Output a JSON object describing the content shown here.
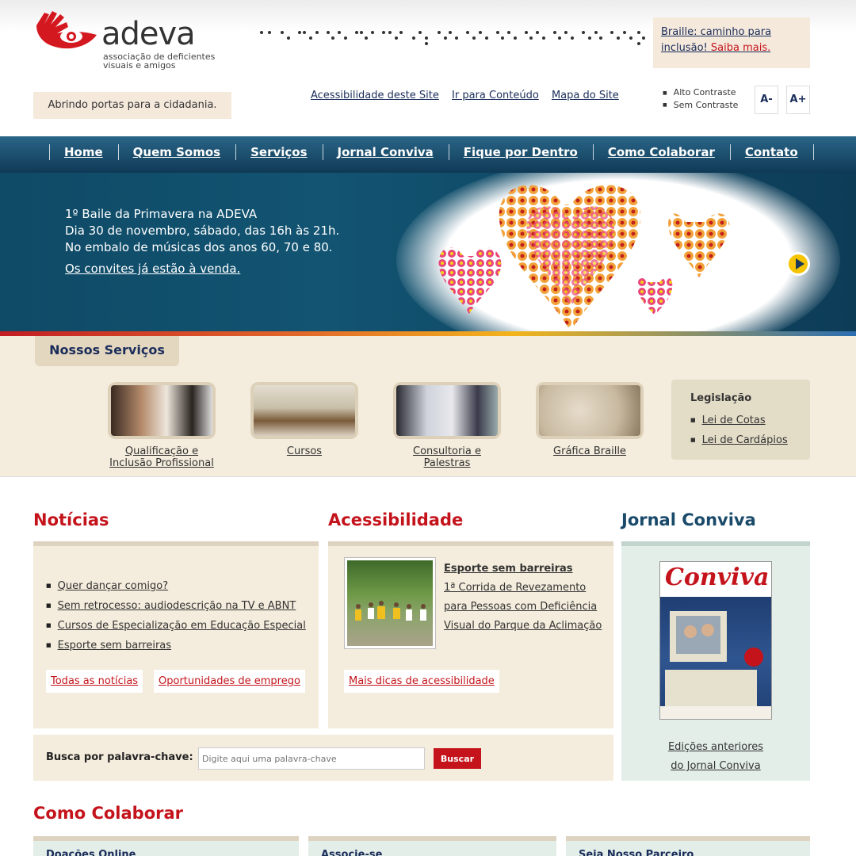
{
  "header": {
    "logo_word": "adeva",
    "logo_sub": "associação de deficientes visuais e amigos",
    "braille_box": {
      "text": "Braille: caminho para inclusão!",
      "more": "Saiba mais."
    },
    "tagline": "Abrindo portas para a cidadania.",
    "top_links": [
      "Acessibilidade deste Site",
      "Ir para Conteúdo",
      "Mapa do Site"
    ],
    "contrast": [
      "Alto Contraste",
      "Sem Contraste"
    ],
    "font_buttons": [
      "A-",
      "A+"
    ]
  },
  "nav": [
    "Home",
    "Quem Somos",
    "Serviços",
    "Jornal Conviva",
    "Fique por Dentro",
    "Como Colaborar",
    "Contato"
  ],
  "banner": {
    "lines": [
      "1º Baile da Primavera na ADEVA",
      "Dia 30 de novembro, sábado, das 16h às 21h.",
      "No embalo de músicas dos anos 60, 70 e 80."
    ],
    "link": "Os convites já estão à venda."
  },
  "services": {
    "title": "Nossos Serviços",
    "items": [
      {
        "label": "Qualificação e Inclusão Profissional"
      },
      {
        "label": "Cursos"
      },
      {
        "label": "Consultoria e Palestras"
      },
      {
        "label": "Gráfica Braille"
      }
    ],
    "legislacao": {
      "title": "Legislação",
      "items": [
        "Lei de Cotas",
        "Lei de Cardápios"
      ]
    }
  },
  "noticias": {
    "title": "Notícias",
    "items": [
      "Quer dançar comigo?",
      "Sem retrocesso: audiodescrição na TV e ABNT",
      "Cursos de Especialização em Educação Especial",
      "Esporte sem barreiras"
    ],
    "links": [
      "Todas as notícias",
      "Oportunidades de emprego"
    ]
  },
  "acessibilidade": {
    "title": "Acessibilidade",
    "headline": "Esporte sem barreiras",
    "text": "1ª Corrida de Revezamento para Pessoas com Deficiência Visual do Parque da Aclimação",
    "link": "Mais dicas de acessibilidade"
  },
  "jornal": {
    "title": "Jornal Conviva",
    "cover_title": "Conviva",
    "links": [
      "Edições anteriores",
      "do Jornal Conviva"
    ]
  },
  "search": {
    "label": "Busca por palavra-chave:",
    "placeholder": "Digite aqui uma palavra-chave",
    "button": "Buscar"
  },
  "colaborar": {
    "title": "Como Colaborar",
    "cards": [
      "Doações Online",
      "Associe-se",
      "Seja Nosso Parceiro"
    ]
  },
  "colors": {
    "brand_red": "#c4131b",
    "navy": "#1a2d5a",
    "beige": "#f4ecdc",
    "nav_blue": "#1b4d6e"
  }
}
